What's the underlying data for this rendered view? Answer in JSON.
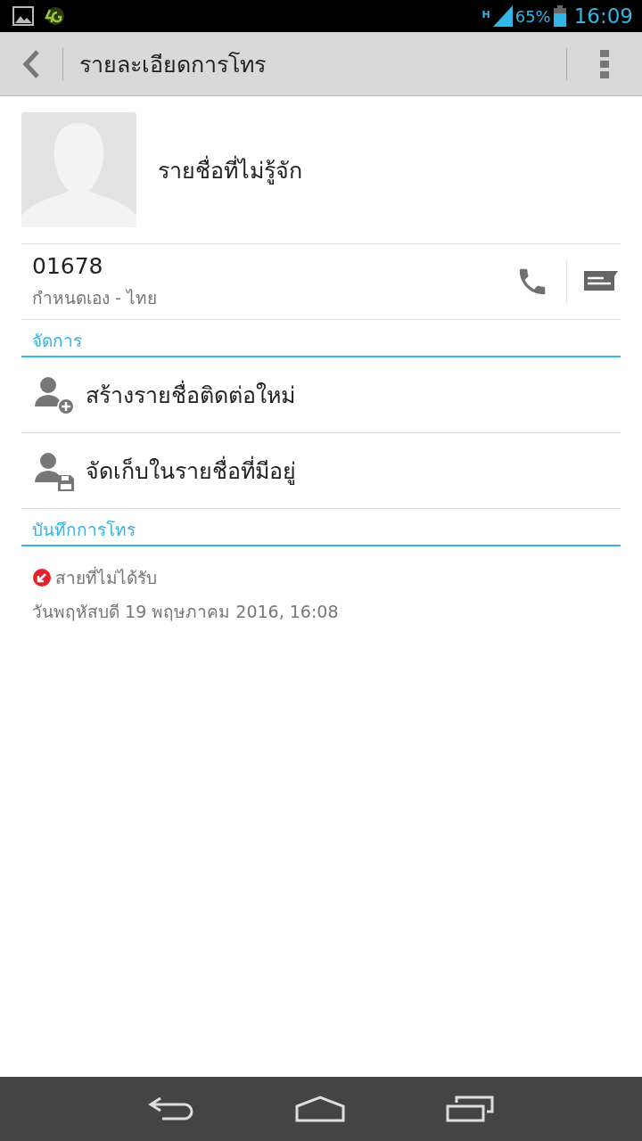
{
  "status_bar": {
    "network_type": "H",
    "battery": "65%",
    "time": "16:09"
  },
  "toolbar": {
    "title": "รายละเอียดการโทร"
  },
  "contact": {
    "name": "รายชื่อที่ไม่รู้จัก",
    "number": "01678",
    "number_label": "กำหนดเอง - ไทย"
  },
  "sections": [
    {
      "header": "จัดการ",
      "kind": "actions",
      "items": [
        {
          "kind": "add",
          "label": "สร้างรายชื่อติดต่อใหม่"
        },
        {
          "kind": "save",
          "label": "จัดเก็บในรายชื่อที่มีอยู่"
        }
      ]
    },
    {
      "header": "บันทึกการโทร",
      "kind": "log",
      "items": [
        {
          "kind": "missed",
          "label": "สายที่ไม่ได้รับ",
          "date": "วันพฤหัสบดี 19 พฤษภาคม 2016, 16:08"
        }
      ]
    }
  ]
}
